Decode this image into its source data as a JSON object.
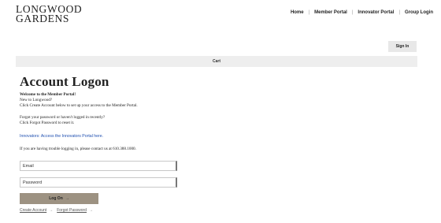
{
  "logo": {
    "line1": "LONGWOOD",
    "line2": "GARDENS"
  },
  "topnav": [
    {
      "label": "Home"
    },
    {
      "label": "Member Portal"
    },
    {
      "label": "Innovator Portal"
    },
    {
      "label": "Group Login"
    }
  ],
  "nav_separator": "|",
  "signin_label": "Sign In",
  "cart_label": "Cart",
  "page_title": "Account Logon",
  "welcome": {
    "heading": "Welcome to the Member Portal!",
    "line1": "New to Longwood?",
    "line2": "Click Create Account below to set up your access to the Member Portal."
  },
  "forgot": {
    "line1": "Forgot your password or haven't logged in recently?",
    "line2": "Click Forgot Password to reset it."
  },
  "innovators_link": "Innovators: Access the Innovators Portal here.",
  "trouble_text": "If you are having trouble logging in, please contact us at 610.388.1000.",
  "form": {
    "email_placeholder": "Email",
    "password_placeholder": "Password",
    "logon_label": "Log On",
    "arrow": "→"
  },
  "bottom_links": {
    "create_account": "Create Account",
    "forgot_password": "Forgot Password",
    "arrow": "→"
  }
}
